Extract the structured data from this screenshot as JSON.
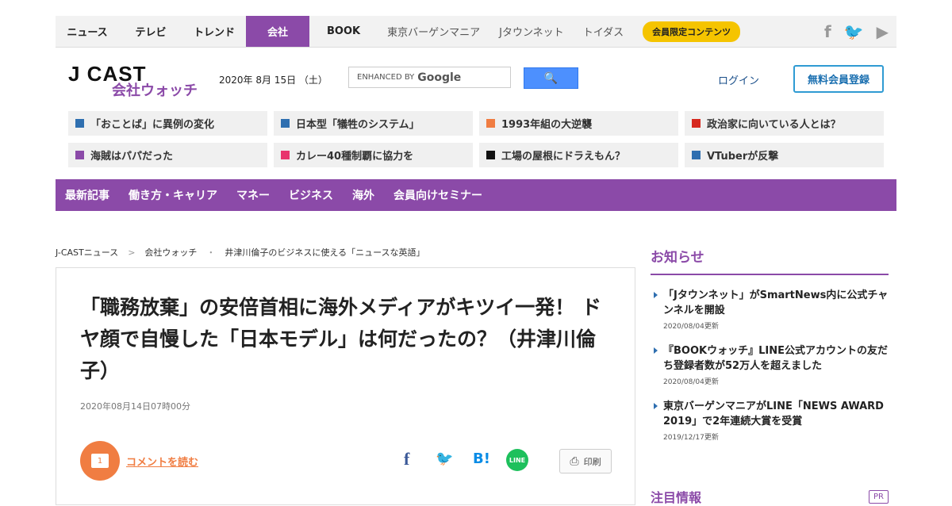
{
  "topnav": {
    "main": [
      "ニュース",
      "テレビ",
      "トレンド",
      "会社",
      "BOOK"
    ],
    "active_index": 3,
    "sub": [
      "東京バーゲンマニア",
      "Jタウンネット",
      "トイダス"
    ],
    "badge": "会員限定コンテンツ",
    "social": [
      "facebook-icon",
      "twitter-icon",
      "youtube-icon"
    ],
    "social_glyphs": {
      "facebook": "f",
      "twitter": "🐦",
      "youtube": "▶"
    }
  },
  "logo": {
    "main": "J CAST",
    "sub": "会社ウォッチ"
  },
  "date": "2020年 8月 15日 （土）",
  "search": {
    "label": "ENHANCED BY",
    "brand": "Google",
    "button_glyph": "🔍"
  },
  "login": "ログイン",
  "register": "無料会員登録",
  "topics": [
    {
      "label": "「おことば」に異例の変化",
      "color": "#2f6fb0"
    },
    {
      "label": "日本型「犠牲のシステム」",
      "color": "#2f6fb0"
    },
    {
      "label": "1993年組の大逆襲",
      "color": "#f07d42"
    },
    {
      "label": "政治家に向いている人とは？",
      "color": "#d6281f"
    },
    {
      "label": "海賊はパパだった",
      "color": "#8b4aa8"
    },
    {
      "label": "カレー40種制覇に協力を",
      "color": "#e8336d"
    },
    {
      "label": "工場の屋根にドラえもん？",
      "color": "#111111"
    },
    {
      "label": "VTuberが反撃",
      "color": "#2f6fb0"
    }
  ],
  "categories": [
    "最新記事",
    "働き方・キャリア",
    "マネー",
    "ビジネス",
    "海外",
    "会員向けセミナー"
  ],
  "breadcrumb": [
    "J-CASTニュース",
    "会社ウォッチ",
    "井津川倫子のビジネスに使える「ニュースな英語」"
  ],
  "breadcrumb_seps": [
    ">",
    "・"
  ],
  "article": {
    "title": "「職務放棄」の安倍首相に海外メディアがキツイ一発！ ドヤ顔で自慢した「日本モデル」は何だったの？（井津川倫子）",
    "pubdate": "2020年08月14日07時00分",
    "comment_count": "1",
    "comment_link": "コメントを読む",
    "share_glyphs": {
      "facebook": "f",
      "twitter": "🐦",
      "hatena": "B!",
      "line": "LINE"
    },
    "print": "印刷"
  },
  "sidebar": {
    "title": "お知らせ",
    "news": [
      {
        "title": "「Jタウンネット」がSmartNews内に公式チャンネルを開設",
        "date": "2020/08/04更新"
      },
      {
        "title": "『BOOKウォッチ』LINE公式アカウントの友だち登録者数が52万人を超えました",
        "date": "2020/08/04更新"
      },
      {
        "title": "東京バーゲンマニアがLINE「NEWS AWARD 2019」で2年連続大賞を受賞",
        "date": "2019/12/17更新"
      }
    ],
    "section2": "注目情報",
    "pr": "PR"
  },
  "colors": {
    "brand_purple": "#8b4aa8",
    "accent_orange": "#f07d42",
    "badge_yellow": "#f5c400"
  }
}
